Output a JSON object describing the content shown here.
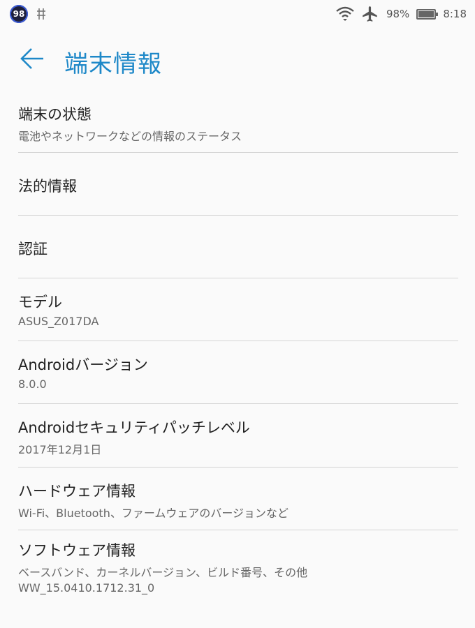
{
  "status_bar": {
    "notification_badge": "98",
    "battery_percent": "98%",
    "battery_level": 0.98,
    "time": "8:18",
    "icons": [
      "usb-debug-icon",
      "wifi-icon",
      "airplane-mode-icon",
      "battery-icon"
    ]
  },
  "header": {
    "back_icon": "arrow-left-icon",
    "title": "端末情報",
    "accent_color": "#1e88c8"
  },
  "items": [
    {
      "title": "端末の状態",
      "summary": "電池やネットワークなどの情報のステータス"
    },
    {
      "title": "法的情報",
      "summary": ""
    },
    {
      "title": "認証",
      "summary": ""
    },
    {
      "title": "モデル",
      "summary": "ASUS_Z017DA"
    },
    {
      "title": "Androidバージョン",
      "summary": "8.0.0"
    },
    {
      "title": "Androidセキュリティパッチレベル",
      "summary": "2017年12月1日"
    },
    {
      "title": "ハードウェア情報",
      "summary": "Wi-Fi、Bluetooth、ファームウェアのバージョンなど"
    },
    {
      "title": "ソフトウェア情報",
      "summary": "ベースバンド、カーネルバージョン、ビルド番号、その他",
      "summary2": "WW_15.0410.1712.31_0"
    }
  ]
}
